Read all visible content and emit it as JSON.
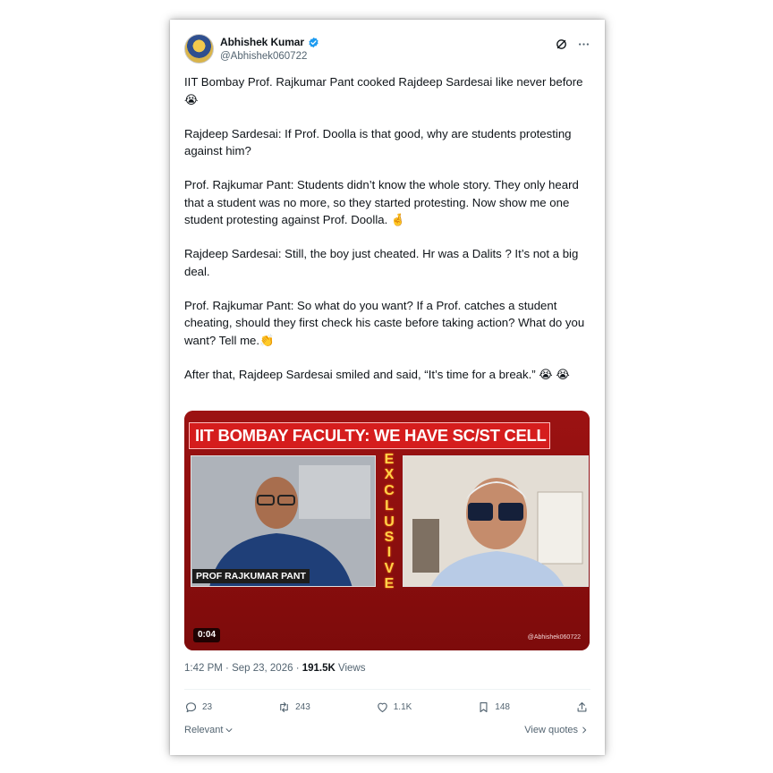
{
  "author": {
    "name": "Abhishek Kumar",
    "handle": "@Abhishek060722",
    "verified": true
  },
  "header_icons": [
    "grok-icon",
    "more-icon"
  ],
  "tweet": {
    "paragraphs": [
      "IIT Bombay Prof. Rajkumar Pant cooked Rajdeep Sardesai like never before 😭",
      "Rajdeep Sardesai: If Prof. Doolla is that good, why are students protesting against him?",
      "Prof. Rajkumar Pant: Students didn’t know the whole story. They only heard that a student was no more, so they started protesting. Now show me one student protesting against Prof. Doolla. 🤞",
      "Rajdeep Sardesai: Still, the boy just cheated. Hr was a Dalits ? It’s not a big deal.",
      "Prof. Rajkumar Pant: So what do you want? If a Prof. catches a student cheating, should they first check his caste before taking action? What do you want? Tell me.👏",
      "After that, Rajdeep Sardesai smiled and said, “It’s time for a break.” 😭 😭"
    ]
  },
  "media": {
    "banner": "IIT BOMBAY FACULTY: WE HAVE SC/ST CELL",
    "side_label": "EXCLUSIVE",
    "nameplate": "PROF RAJKUMAR PANT",
    "duration": "0:04",
    "watermark": "@Abhishek060722",
    "colors": {
      "background": "#8c0f0f",
      "banner": "#d51d1d",
      "side_label": "#ffd24a"
    }
  },
  "meta": {
    "time": "1:42 PM",
    "date": "Sep 23, 2026",
    "views_count": "191.5K",
    "views_label": "Views"
  },
  "actions": {
    "replies": "23",
    "reposts": "243",
    "likes": "1.1K",
    "bookmarks": "148"
  },
  "footer": {
    "sort_label": "Relevant",
    "quotes_label": "View quotes"
  },
  "colors": {
    "verified": "#1d9bf0",
    "text": "#0f1419",
    "muted": "#536471"
  }
}
